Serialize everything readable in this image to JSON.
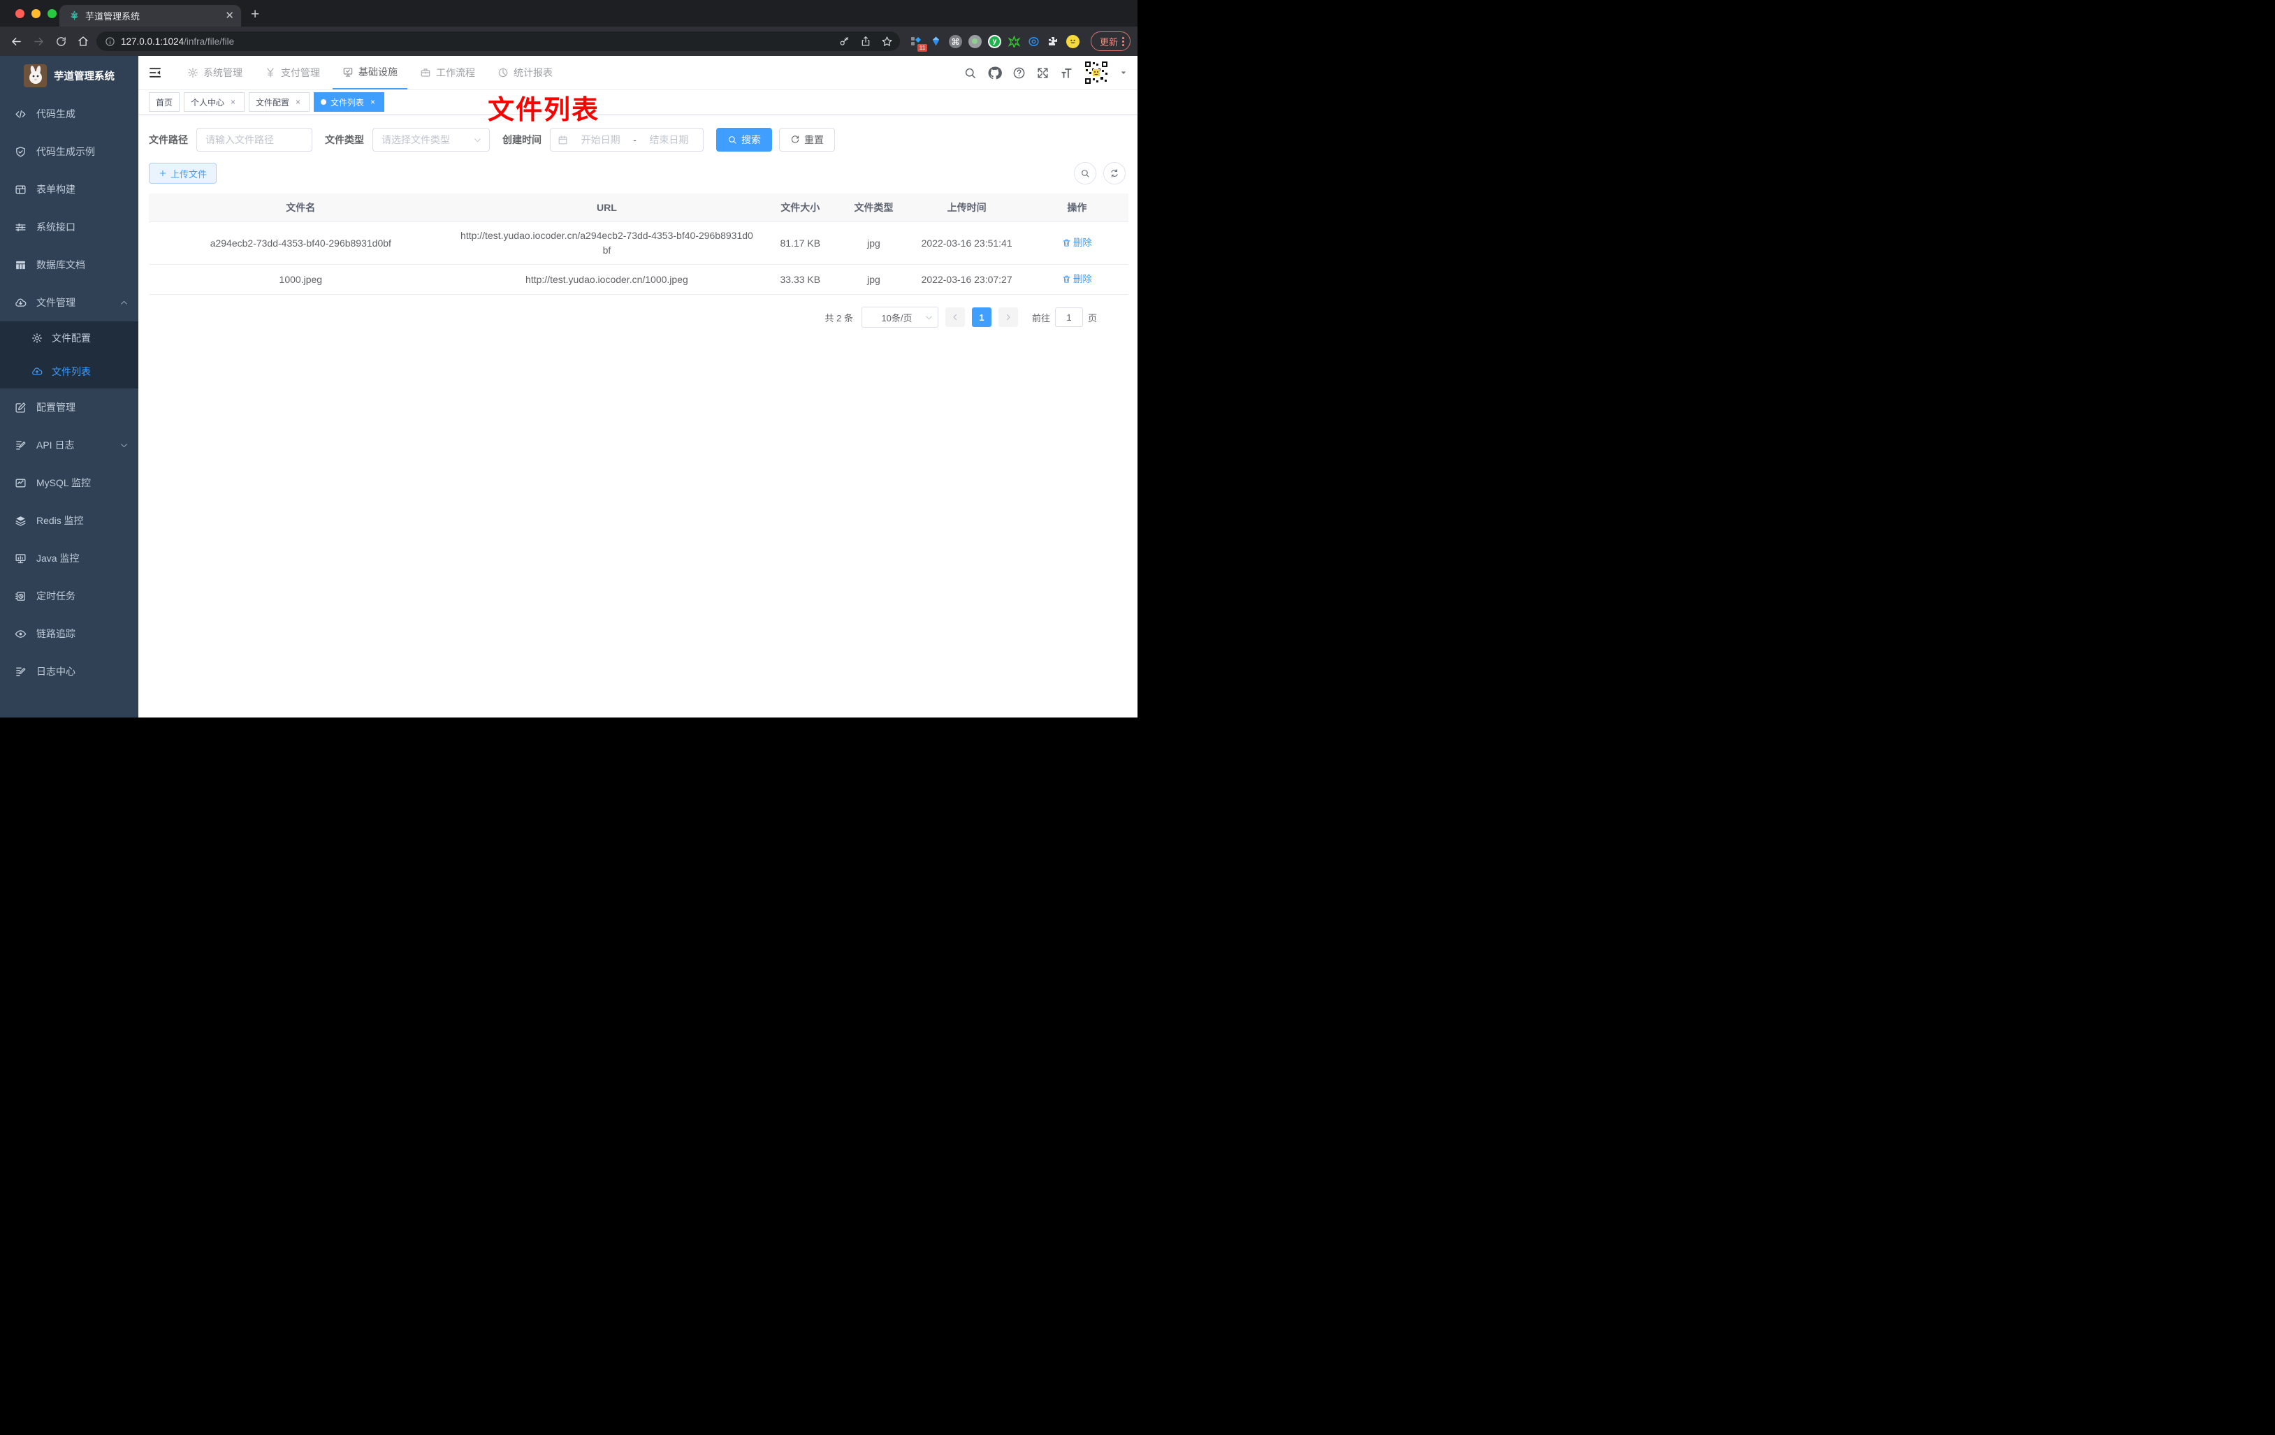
{
  "browser": {
    "tab": {
      "title": "芋道管理系统"
    },
    "url": {
      "host": "127.0.0.1:1024",
      "path": "/infra/file/file"
    },
    "ext_badge": "11",
    "update_label": "更新"
  },
  "sidebar": {
    "logo_title": "芋道管理系统",
    "items": [
      {
        "label": "代码生成",
        "icon": "code-icon"
      },
      {
        "label": "代码生成示例",
        "icon": "shield-check-icon"
      },
      {
        "label": "表单构建",
        "icon": "form-grid-icon"
      },
      {
        "label": "系统接口",
        "icon": "sliders-icon"
      },
      {
        "label": "数据库文档",
        "icon": "table-icon"
      },
      {
        "label": "文件管理",
        "icon": "cloud-download-icon",
        "expanded": true
      },
      {
        "label": "文件配置",
        "icon": "gear-icon"
      },
      {
        "label": "文件列表",
        "icon": "cloud-upload-icon",
        "active": true
      },
      {
        "label": "配置管理",
        "icon": "pen-square-icon"
      },
      {
        "label": "API 日志",
        "icon": "note-edit-icon",
        "collapsed": true
      },
      {
        "label": "MySQL 监控",
        "icon": "chart-monitor-icon"
      },
      {
        "label": "Redis 监控",
        "icon": "layers-icon"
      },
      {
        "label": "Java 监控",
        "icon": "screen-chart-icon"
      },
      {
        "label": "定时任务",
        "icon": "timer-icon"
      },
      {
        "label": "链路追踪",
        "icon": "eye-icon"
      },
      {
        "label": "日志中心",
        "icon": "log-edit-icon"
      }
    ]
  },
  "topnav": {
    "items": [
      {
        "label": "系统管理",
        "icon": "gear-icon"
      },
      {
        "label": "支付管理",
        "icon": "yen-icon"
      },
      {
        "label": "基础设施",
        "icon": "monitor-check-icon",
        "active": true
      },
      {
        "label": "工作流程",
        "icon": "briefcase-icon"
      },
      {
        "label": "统计报表",
        "icon": "dashboard-icon"
      }
    ]
  },
  "tags": [
    {
      "label": "首页",
      "closable": false
    },
    {
      "label": "个人中心",
      "closable": true
    },
    {
      "label": "文件配置",
      "closable": true
    },
    {
      "label": "文件列表",
      "closable": true,
      "active": true
    }
  ],
  "annotation": "文件列表",
  "filter": {
    "path_label": "文件路径",
    "path_placeholder": "请输入文件路径",
    "type_label": "文件类型",
    "type_placeholder": "请选择文件类型",
    "date_label": "创建时间",
    "date_start": "开始日期",
    "date_sep": "-",
    "date_end": "结束日期",
    "search": "搜索",
    "reset": "重置"
  },
  "actions": {
    "upload": "上传文件"
  },
  "table": {
    "headers": [
      "文件名",
      "URL",
      "文件大小",
      "文件类型",
      "上传时间",
      "操作"
    ],
    "rows": [
      {
        "name": "a294ecb2-73dd-4353-bf40-296b8931d0bf",
        "url": "http://test.yudao.iocoder.cn/a294ecb2-73dd-4353-bf40-296b8931d0bf",
        "size": "81.17 KB",
        "type": "jpg",
        "time": "2022-03-16 23:51:41",
        "action": "删除"
      },
      {
        "name": "1000.jpeg",
        "url": "http://test.yudao.iocoder.cn/1000.jpeg",
        "size": "33.33 KB",
        "type": "jpg",
        "time": "2022-03-16 23:07:27",
        "action": "删除"
      }
    ]
  },
  "pagination": {
    "total": "共 2 条",
    "page_size": "10条/页",
    "current": "1",
    "goto": "前往",
    "goto_value": "1",
    "page_unit": "页"
  },
  "icons": {
    "favicon": "teal-plant",
    "search": "magnifier",
    "github": "octocat",
    "help": "question-circle",
    "fullscreen": "expand-arrows",
    "font_size": "tT",
    "reset": "refresh-arrow",
    "delete": "trash-can"
  },
  "colors": {
    "accent": "#409eff",
    "sidebar_bg": "#304156",
    "submenu_bg": "#1f2d3d",
    "annotation_red": "#f70400",
    "update_chip": "#f28b82",
    "traffic_red": "#ff5f57",
    "traffic_yellow": "#febc2e",
    "traffic_green": "#28c840"
  }
}
